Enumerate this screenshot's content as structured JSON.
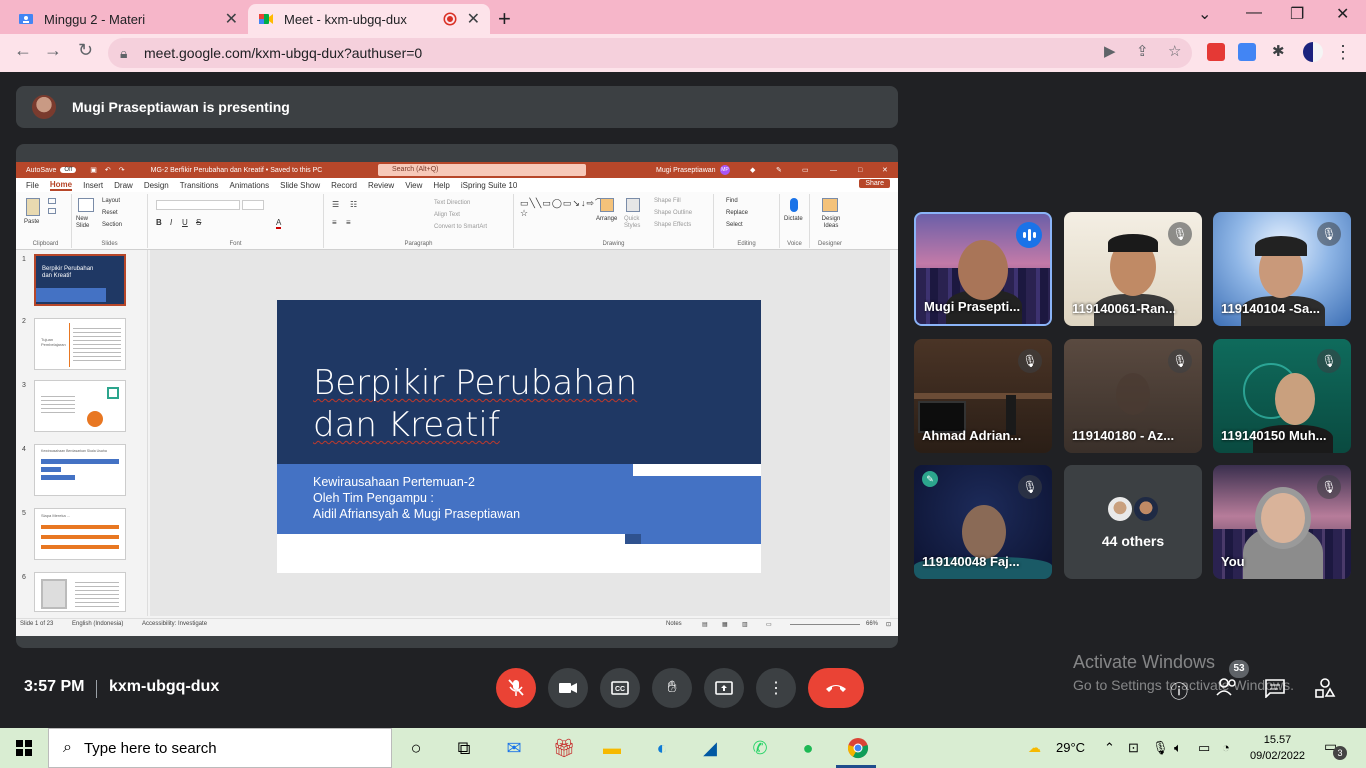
{
  "browser": {
    "tabs": [
      {
        "label": "Minggu 2 - Materi"
      },
      {
        "label": "Meet - kxm-ubgq-dux"
      }
    ],
    "url": "meet.google.com/kxm-ubgq-dux?authuser=0"
  },
  "presenter_bar": {
    "text": "Mugi Praseptiawan is presenting"
  },
  "powerpoint": {
    "title_bar": {
      "autosave": "AutoSave",
      "autosave_state": "Off",
      "filename": "MG-2 Berfikir Perubahan dan Kreatif • Saved to this PC",
      "search_placeholder": "Search (Alt+Q)",
      "user": "Mugi Praseptiawan",
      "user_initials": "MP"
    },
    "menu": [
      "File",
      "Home",
      "Insert",
      "Draw",
      "Design",
      "Transitions",
      "Animations",
      "Slide Show",
      "Record",
      "Review",
      "View",
      "Help",
      "iSpring Suite 10"
    ],
    "share_label": "Share",
    "ribbon": {
      "paste": "Paste",
      "new_slide": "New Slide",
      "layout": "Layout",
      "reset": "Reset",
      "section": "Section",
      "text_direction": "Text Direction",
      "align_text": "Align Text",
      "convert_smartart": "Convert to SmartArt",
      "arrange": "Arrange",
      "quick_styles": "Quick Styles",
      "shape_fill": "Shape Fill",
      "shape_outline": "Shape Outline",
      "shape_effects": "Shape Effects",
      "find": "Find",
      "replace": "Replace",
      "select": "Select",
      "dictate": "Dictate",
      "design_ideas": "Design Ideas",
      "groups": [
        "Clipboard",
        "Slides",
        "Font",
        "Paragraph",
        "Drawing",
        "Editing",
        "Voice",
        "Designer"
      ]
    },
    "thumbnail_numbers": [
      "1",
      "2",
      "3",
      "4",
      "5",
      "6"
    ],
    "thumbnail_texts": {
      "t1_title": "Berpikir Perubahan dan Kreatif",
      "t2_title": "Tujuan Pembelajaran",
      "t4_title": "Kewirausahaan Berdasarkan Skala Usaha",
      "t5_title": "Siapa Mereka ..."
    },
    "slide": {
      "title_line1": "Berpikir Perubahan",
      "title_line2": "dan Kreatif",
      "sub1": "Kewirausahaan Pertemuan-2",
      "sub2": "Oleh Tim Pengampu :",
      "sub3": "Aidil Afriansyah & Mugi Praseptiawan"
    },
    "status": {
      "slide_count": "Slide 1 of 23",
      "language": "English (Indonesia)",
      "accessibility": "Accessibility: Investigate",
      "notes": "Notes",
      "zoom": "66%"
    }
  },
  "participants": [
    {
      "name": "Mugi Prasepti...",
      "muted": false,
      "speaking": true
    },
    {
      "name": "119140061-Ran...",
      "muted": true
    },
    {
      "name": "119140104 -Sa...",
      "muted": true
    },
    {
      "name": "Ahmad Adrian...",
      "muted": true
    },
    {
      "name": "119140180 - Az...",
      "muted": true
    },
    {
      "name": "119140150 Muh...",
      "muted": true
    },
    {
      "name": "119140048 Faj...",
      "muted": true
    },
    {
      "name": "44 others",
      "muted": false
    },
    {
      "name": "You",
      "muted": true
    }
  ],
  "footer": {
    "time": "3:57 PM",
    "meeting_code": "kxm-ubgq-dux",
    "people_count": "53"
  },
  "watermark": {
    "line1": "Activate Windows",
    "line2": "Go to Settings to activate Windows."
  },
  "taskbar": {
    "search_placeholder": "Type here to search",
    "temperature": "29°C",
    "clock_time": "15.57",
    "clock_date": "09/02/2022",
    "notification_count": "3"
  },
  "colors": {
    "meet_bg": "#202124",
    "tile_bg": "#3c4043",
    "end_call": "#ea4335",
    "browser_tab_strip": "#f6b6c9",
    "ppt_accent": "#b7472a",
    "slide_dark_blue": "#1f3864",
    "slide_band_blue": "#4472c4",
    "taskbar_bg": "#d9edd2"
  }
}
